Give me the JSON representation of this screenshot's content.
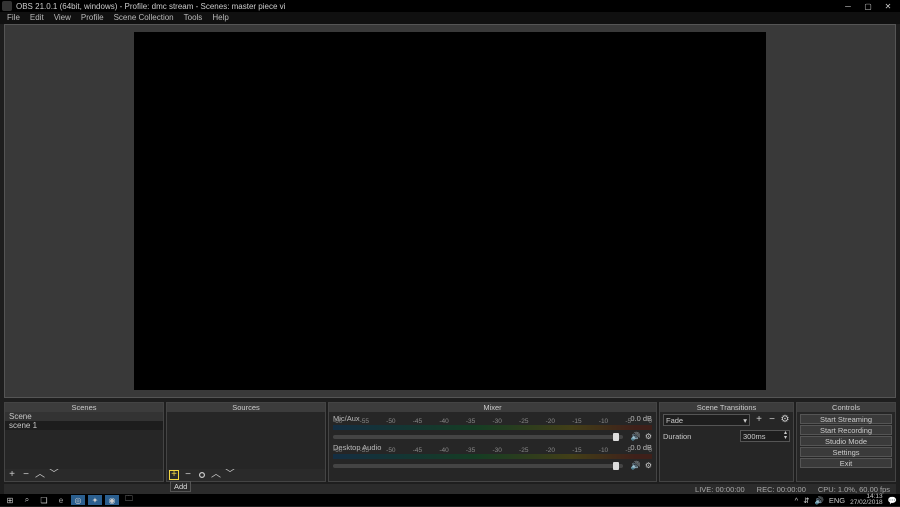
{
  "titlebar": {
    "text": "OBS 21.0.1 (64bit, windows) - Profile: dmc stream - Scenes: master piece vi"
  },
  "menu": {
    "items": [
      "File",
      "Edit",
      "View",
      "Profile",
      "Scene Collection",
      "Tools",
      "Help"
    ]
  },
  "panels": {
    "scenes": {
      "title": "Scenes",
      "header_row": "Scene",
      "items": [
        "scene 1"
      ]
    },
    "sources": {
      "title": "Sources",
      "tooltip": "Add"
    },
    "mixer": {
      "title": "Mixer",
      "channels": [
        {
          "name": "Mic/Aux",
          "db": "0.0 dB"
        },
        {
          "name": "Desktop Audio",
          "db": "0.0 dB"
        }
      ],
      "ticks": [
        "-60",
        "-55",
        "-50",
        "-45",
        "-40",
        "-35",
        "-30",
        "-25",
        "-20",
        "-15",
        "-10",
        "-5",
        "0"
      ]
    },
    "transitions": {
      "title": "Scene Transitions",
      "mode": "Fade",
      "duration_label": "Duration",
      "duration_value": "300ms"
    },
    "controls": {
      "title": "Controls",
      "buttons": [
        "Start Streaming",
        "Start Recording",
        "Studio Mode",
        "Settings",
        "Exit"
      ]
    }
  },
  "status": {
    "live": "LIVE: 00:00:00",
    "rec": "REC: 00:00:00",
    "cpu": "CPU: 1.0%, 60.00 fps"
  },
  "taskbar": {
    "lang": "ENG",
    "time": "14:13",
    "date": "27/02/2018"
  }
}
